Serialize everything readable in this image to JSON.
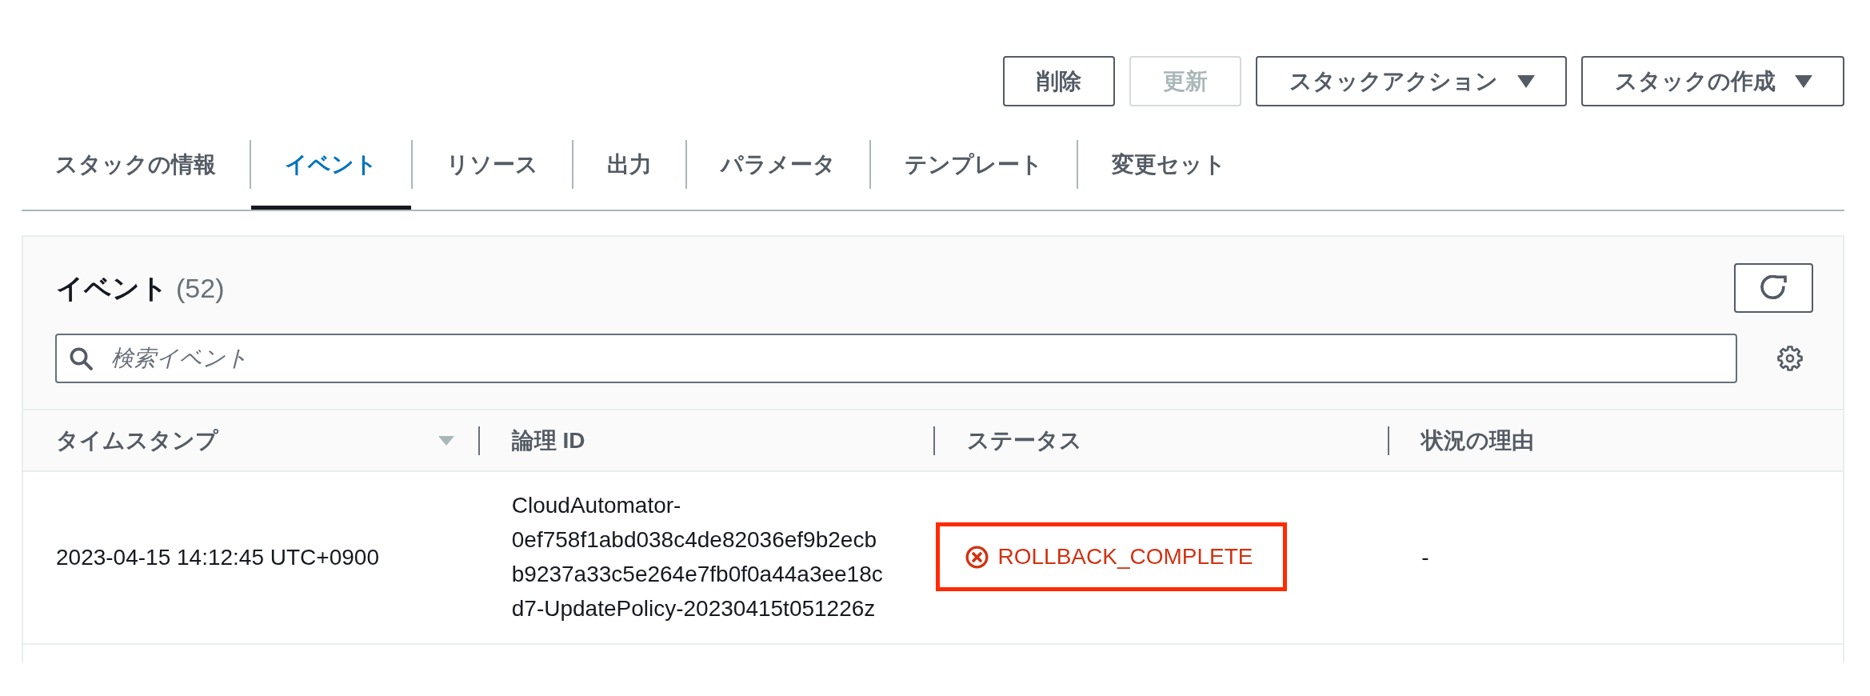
{
  "stack_actions": [
    {
      "label": "削除",
      "disabled": false,
      "dropdown": false
    },
    {
      "label": "更新",
      "disabled": true,
      "dropdown": false
    },
    {
      "label": "スタックアクション",
      "disabled": false,
      "dropdown": true
    },
    {
      "label": "スタックの作成",
      "disabled": false,
      "dropdown": true
    }
  ],
  "tabs": [
    {
      "label": "スタックの情報",
      "selected": false
    },
    {
      "label": "イベント",
      "selected": true
    },
    {
      "label": "リソース",
      "selected": false
    },
    {
      "label": "出力",
      "selected": false
    },
    {
      "label": "パラメータ",
      "selected": false
    },
    {
      "label": "テンプレート",
      "selected": false
    },
    {
      "label": "変更セット",
      "selected": false
    }
  ],
  "events_panel": {
    "title": "イベント",
    "count": "(52)",
    "search": {
      "placeholder": "検索イベント"
    },
    "table": {
      "columns": [
        {
          "label": "タイムスタンプ",
          "sorted": true
        },
        {
          "label": "論理 ID",
          "sorted": false
        },
        {
          "label": "ステータス",
          "sorted": false
        },
        {
          "label": "状況の理由",
          "sorted": false
        }
      ],
      "rows": [
        {
          "timestamp": "2023-04-15 14:12:45 UTC+0900",
          "logical_id": "CloudAutomator-0ef758f1abd038c4de82036ef9b2ecbb9237a33c5e264e7fb0f0a44a3ee18cd7-UpdatePolicy-20230415t051226z",
          "status": {
            "text": "ROLLBACK_COMPLETE",
            "kind": "error",
            "highlighted": true
          },
          "reason": "-"
        }
      ]
    }
  }
}
